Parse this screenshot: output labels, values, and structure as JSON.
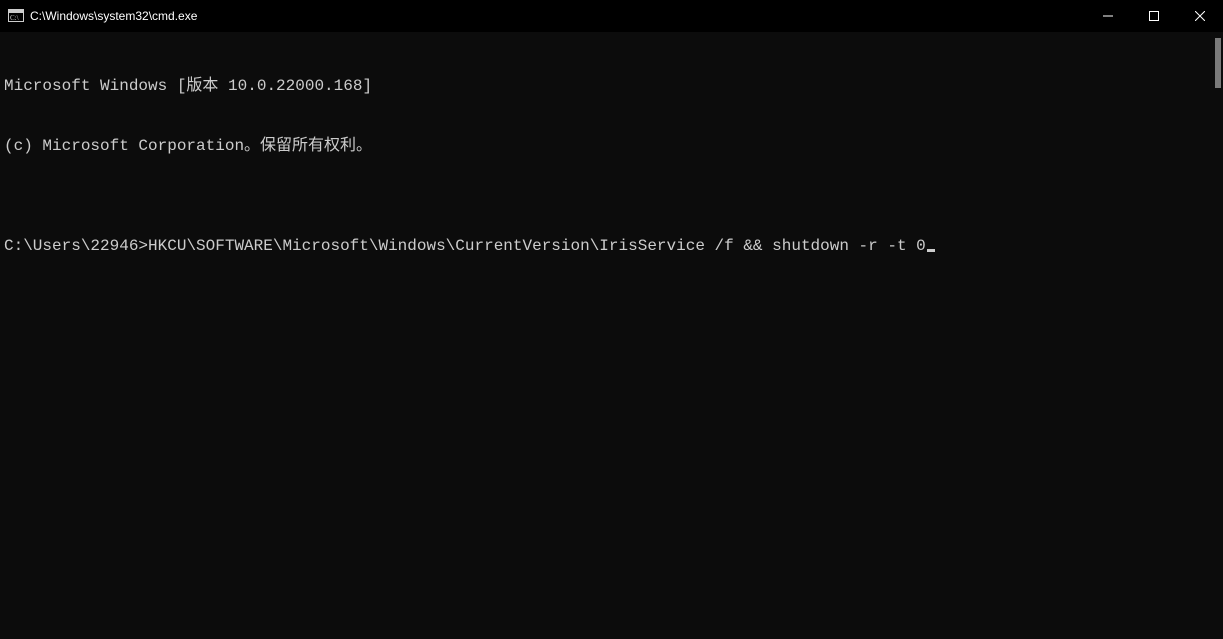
{
  "window": {
    "title": "C:\\Windows\\system32\\cmd.exe"
  },
  "terminal": {
    "line1": "Microsoft Windows [版本 10.0.22000.168]",
    "line2": "(c) Microsoft Corporation。保留所有权利。",
    "blank": "",
    "prompt": "C:\\Users\\22946>",
    "command": "HKCU\\SOFTWARE\\Microsoft\\Windows\\CurrentVersion\\IrisService /f && shutdown -r -t 0"
  },
  "icons": {
    "app": "cmd-icon",
    "minimize": "minimize-icon",
    "maximize": "maximize-icon",
    "close": "close-icon"
  }
}
